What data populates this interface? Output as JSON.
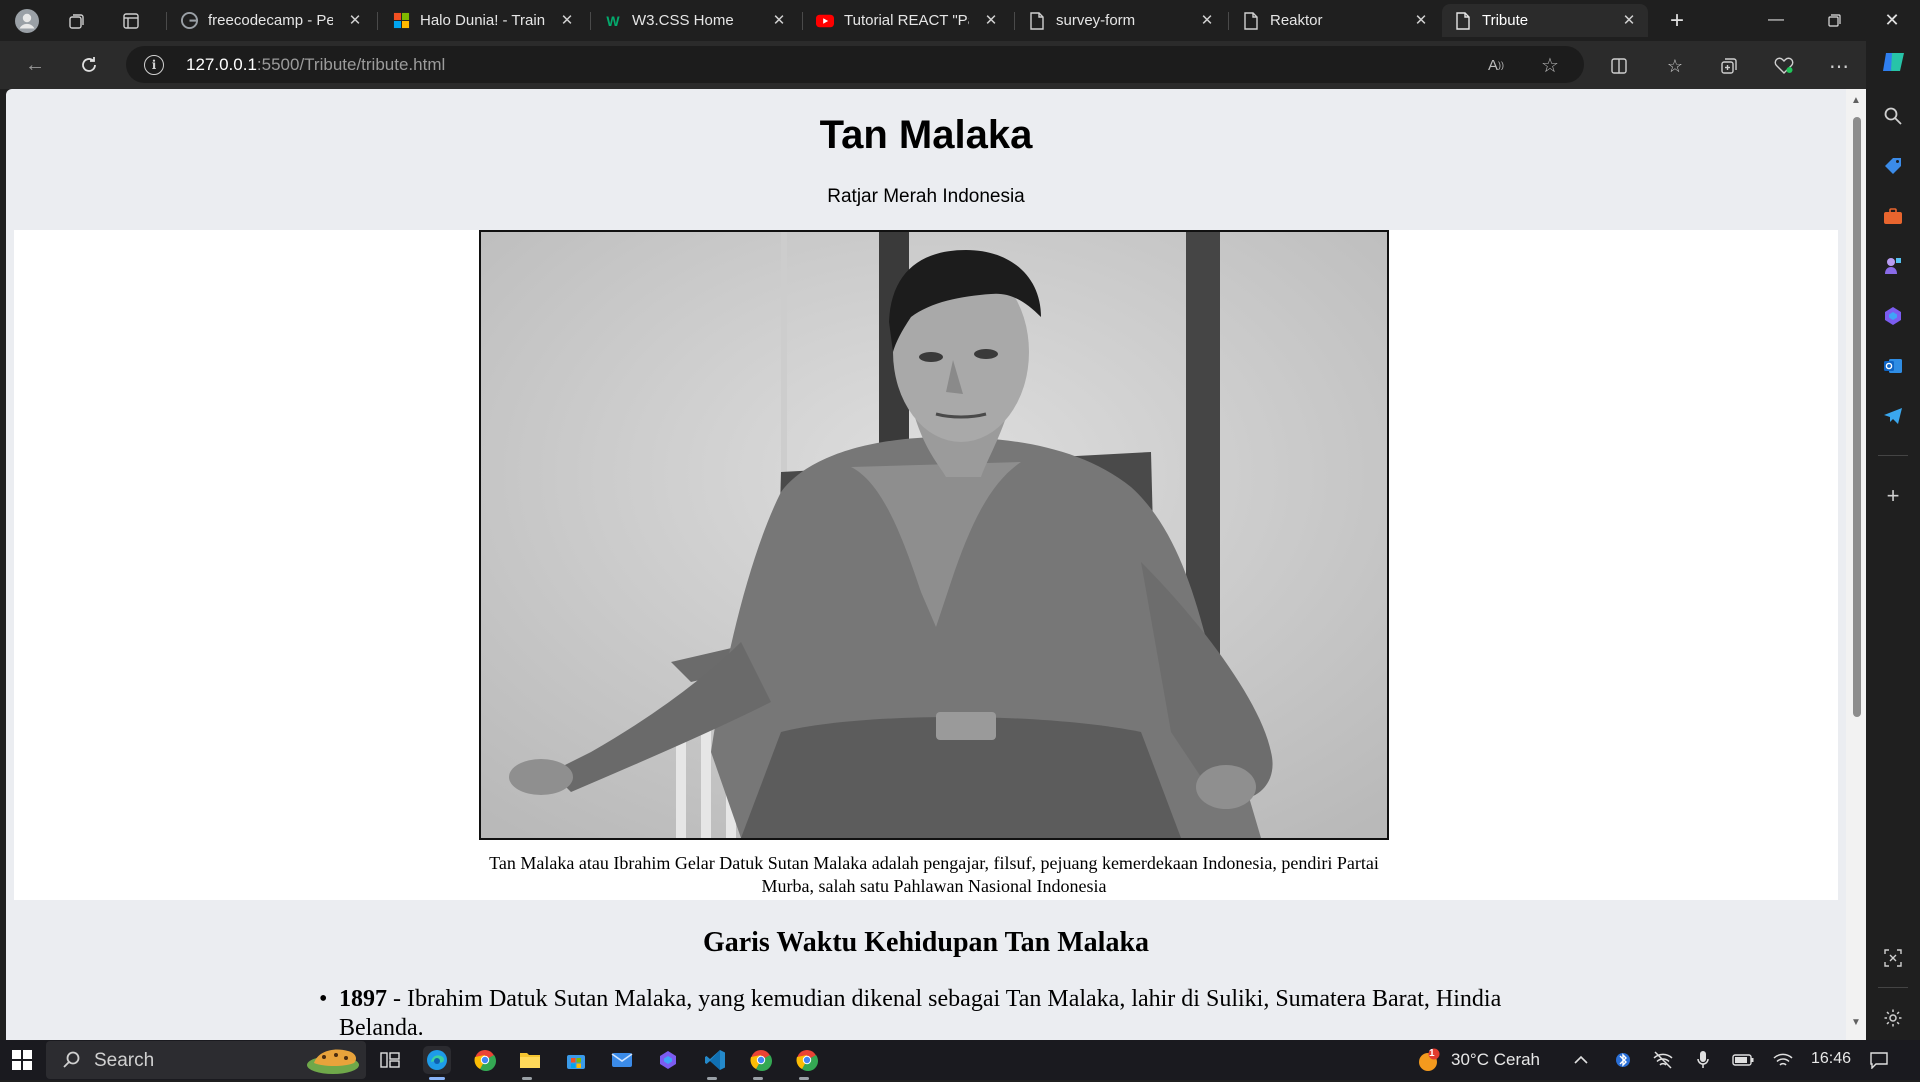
{
  "browser": {
    "tabs": [
      {
        "title": "freecodecamp - Per",
        "favicon": "google-favicon",
        "active": false
      },
      {
        "title": "Halo Dunia! - Trainin",
        "favicon": "microsoft-favicon",
        "active": false
      },
      {
        "title": "W3.CSS Home",
        "favicon": "w3schools-favicon",
        "active": false
      },
      {
        "title": "Tutorial REACT \"Pal",
        "favicon": "youtube-favicon",
        "active": false
      },
      {
        "title": "survey-form",
        "favicon": "page-favicon",
        "active": false
      },
      {
        "title": "Reaktor",
        "favicon": "page-favicon",
        "active": false
      },
      {
        "title": "Tribute",
        "favicon": "page-favicon",
        "active": true
      }
    ],
    "url": {
      "host": "127.0.0.1",
      "rest": ":5500/Tribute/tribute.html"
    }
  },
  "page": {
    "title": "Tan Malaka",
    "subtitle": "Ratjar Merah Indonesia",
    "image_alt": "Tan Malaka seated in a chair",
    "caption": "Tan Malaka atau Ibrahim Gelar Datuk Sutan Malaka adalah pengajar, filsuf, pejuang kemerdekaan Indonesia, pendiri Partai Murba, salah satu Pahlawan Nasional Indonesia",
    "timeline_heading": "Garis Waktu Kehidupan Tan Malaka",
    "timeline": [
      {
        "year": "1897",
        "text": " - Ibrahim Datuk Sutan Malaka, yang kemudian dikenal sebagai Tan Malaka, lahir di Suliki, Sumatera Barat, Hindia Belanda."
      }
    ]
  },
  "taskbar": {
    "search_label": "Search",
    "weather": "30°C Cerah",
    "weather_badge": "1",
    "time": "16:46"
  },
  "colors": {
    "page_bg": "#ebedf1",
    "image_bg": "#ffffff",
    "browser_chrome": "#1f1f1f",
    "accent": "#8ab4f8"
  }
}
